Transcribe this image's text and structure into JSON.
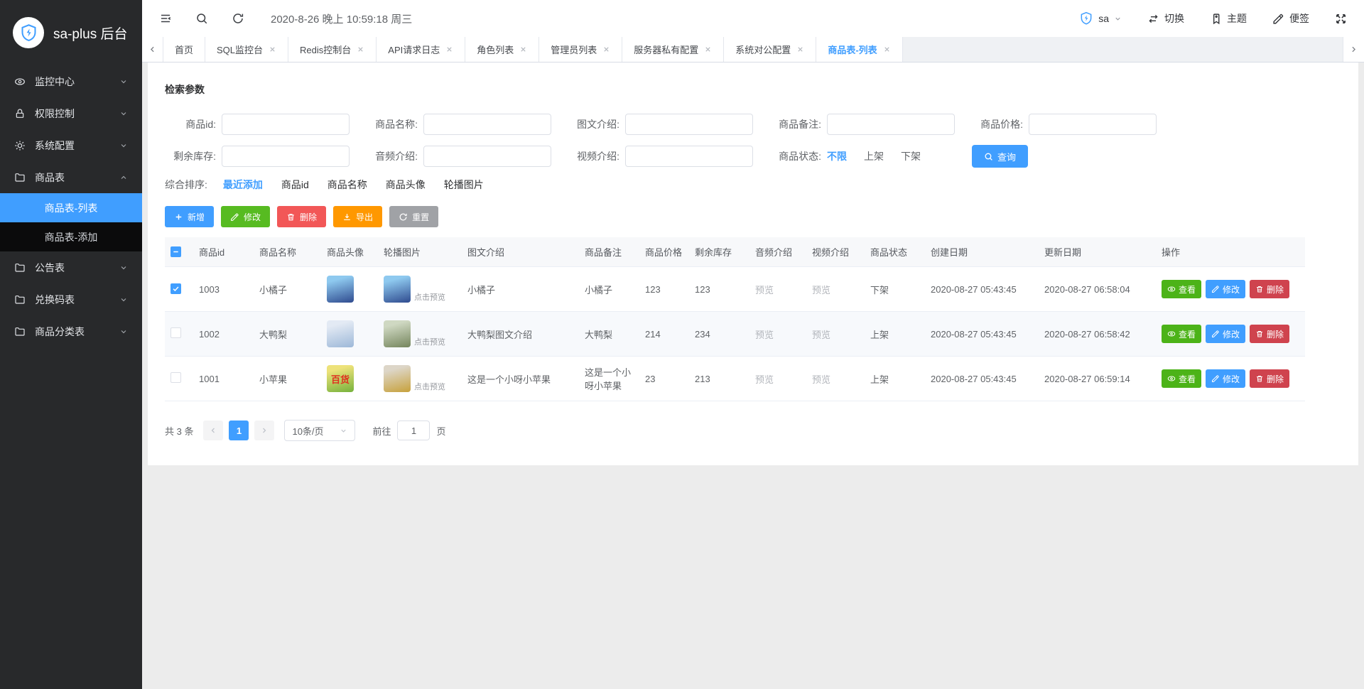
{
  "sidebar": {
    "logo_title": "sa-plus 后台",
    "items": [
      {
        "label": "监控中心"
      },
      {
        "label": "权限控制"
      },
      {
        "label": "系统配置"
      },
      {
        "label": "商品表",
        "children": [
          {
            "label": "商品表-列表",
            "active": true
          },
          {
            "label": "商品表-添加",
            "active": false
          }
        ]
      },
      {
        "label": "公告表"
      },
      {
        "label": "兑换码表"
      },
      {
        "label": "商品分类表"
      }
    ]
  },
  "header": {
    "datetime": "2020-8-26 晚上 10:59:18 周三",
    "username": "sa",
    "switch_label": "切换",
    "theme_label": "主题",
    "note_label": "便签"
  },
  "tabs": [
    {
      "label": "首页",
      "closable": false,
      "active": false
    },
    {
      "label": "SQL监控台",
      "closable": true,
      "active": false
    },
    {
      "label": "Redis控制台",
      "closable": true,
      "active": false
    },
    {
      "label": "API请求日志",
      "closable": true,
      "active": false
    },
    {
      "label": "角色列表",
      "closable": true,
      "active": false
    },
    {
      "label": "管理员列表",
      "closable": true,
      "active": false
    },
    {
      "label": "服务器私有配置",
      "closable": true,
      "active": false
    },
    {
      "label": "系统对公配置",
      "closable": true,
      "active": false
    },
    {
      "label": "商品表-列表",
      "closable": true,
      "active": true
    }
  ],
  "search": {
    "title": "检索参数",
    "labels": {
      "id": "商品id:",
      "name": "商品名称:",
      "intro": "图文介绍:",
      "note": "商品备注:",
      "price": "商品价格:",
      "stock": "剩余库存:",
      "audio": "音频介绍:",
      "video": "视频介绍:",
      "status": "商品状态:"
    },
    "status_options": [
      "不限",
      "上架",
      "下架"
    ],
    "status_selected": "不限",
    "query_label": "查询",
    "sort_label": "综合排序:",
    "sort_options": [
      "最近添加",
      "商品id",
      "商品名称",
      "商品头像",
      "轮播图片"
    ],
    "sort_selected": "最近添加"
  },
  "toolbar": {
    "add": "新增",
    "edit": "修改",
    "delete": "删除",
    "export": "导出",
    "reset": "重置"
  },
  "table": {
    "columns": [
      "商品id",
      "商品名称",
      "商品头像",
      "轮播图片",
      "图文介绍",
      "商品备注",
      "商品价格",
      "剩余库存",
      "音频介绍",
      "视频介绍",
      "商品状态",
      "创建日期",
      "更新日期",
      "操作"
    ],
    "preview_link": "预览",
    "click_preview": "点击预览",
    "actions": {
      "view": "查看",
      "edit": "修改",
      "delete": "删除"
    },
    "rows": [
      {
        "checked": true,
        "id": "1003",
        "name": "小橘子",
        "avatar_label": "",
        "avatar_colors": [
          "#8ec9ef",
          "#2f4b8f"
        ],
        "carousel_colors": [
          "#8ec9ef",
          "#2f4b8f"
        ],
        "intro": "小橘子",
        "note": "小橘子",
        "price": "123",
        "stock": "123",
        "audio": "预览",
        "video": "预览",
        "status": "下架",
        "created": "2020-08-27 05:43:45",
        "updated": "2020-08-27 06:58:04"
      },
      {
        "checked": false,
        "id": "1002",
        "name": "大鸭梨",
        "avatar_label": "",
        "avatar_colors": [
          "#e3eaf4",
          "#9db8d8"
        ],
        "carousel_colors": [
          "#cfd8c2",
          "#74855c"
        ],
        "intro": "大鸭梨图文介绍",
        "note": "大鸭梨",
        "price": "214",
        "stock": "234",
        "audio": "预览",
        "video": "预览",
        "status": "上架",
        "created": "2020-08-27 05:43:45",
        "updated": "2020-08-27 06:58:42"
      },
      {
        "checked": false,
        "id": "1001",
        "name": "小苹果",
        "avatar_label": "百货",
        "avatar_colors": [
          "#ede27a",
          "#76b23c"
        ],
        "carousel_colors": [
          "#ddd6c8",
          "#c7a13b"
        ],
        "intro": "这是一个小呀小苹果",
        "note": "这是一个小呀小苹果",
        "price": "23",
        "stock": "213",
        "audio": "预览",
        "video": "预览",
        "status": "上架",
        "created": "2020-08-27 05:43:45",
        "updated": "2020-08-27 06:59:14"
      }
    ]
  },
  "pagination": {
    "total": "共 3 条",
    "current_page": "1",
    "page_size": "10条/页",
    "goto_label": "前往",
    "goto_value": "1",
    "page_unit": "页"
  },
  "colors": {
    "primary": "#409eff",
    "green": "#57bb21",
    "row_green": "#4cb318",
    "red": "#f25757",
    "row_red": "#cf434e",
    "orange": "#ff9800",
    "gray": "#a0a2a6",
    "sidebar_bg": "#28292b",
    "submenu_bg": "#0b0b0c"
  }
}
